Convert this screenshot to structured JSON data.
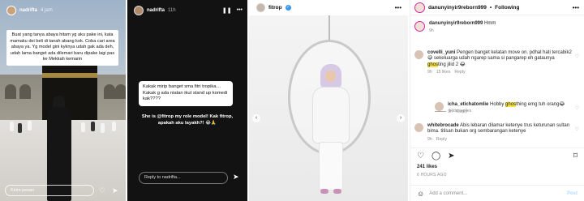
{
  "story1": {
    "username": "nadrifta",
    "time": "4 jam",
    "caption": "Buat yang tanya abaya hitam yg aku pake ini, kata mamaku dei beli di tanah abang kok. Coba cari area abaya ya. Yg model gini kyknya udah gak ada deh, udah lama banget ada dilemari baru dipake lagi pas ke Mekkah kemarin",
    "reply_placeholder": "Kirim pesan",
    "like_icon": "heart-icon",
    "send_icon": "send-icon"
  },
  "story2": {
    "username": "nadrifta",
    "time": "11h",
    "question": "Kakak mirip banget sma fitri tropika… Kakak g ada niatan ikut stand up komedi kak????",
    "answer": "She is @fitrop my role model! Kak fitrop, apakah aku layakh?! 😂🙏",
    "reply_placeholder": "Reply to nadrifta...",
    "pause_icon": "pause-icon",
    "more_icon": "more-icon"
  },
  "post": {
    "username": "fitrop",
    "verified": true
  },
  "comments_panel": {
    "username": "danunyinyir9reborn999",
    "follow_label": "Following",
    "caption_user": "danunyinyir9reborn999",
    "caption_text": "Hmm",
    "caption_age": "9h",
    "comments": [
      {
        "user": "covelli_yuni",
        "text_a": "Pengen banget kelatan move on. pdhal hati tercabik2 😅 sekeluarga udah ngarep sama si pangarep eh gataunya ",
        "highlight": "ghos",
        "text_b": "ting jilid 2 😂",
        "age": "9h",
        "likes": "15 likes",
        "reply": "Reply"
      },
      {
        "user": "icha_etichatomlie",
        "text_a": "Hobby ",
        "highlight": "ghos",
        "text_b": "thing emg tuh orang😂",
        "age": "9h",
        "likes": "",
        "reply": "Reply"
      },
      {
        "user": "whitebrocade",
        "text_a": "Abis lebaran dilamar ketenye trus keturunan sultan bima. titisan bukan org sembarangan ketenye",
        "highlight": "",
        "text_b": "",
        "age": "9h",
        "likes": "",
        "reply": "Reply"
      }
    ],
    "hide_replies": "Hide replies",
    "likes": "241 likes",
    "date": "6 HOURS AGO",
    "add_comment": "Add a comment...",
    "post_label": "Post"
  }
}
